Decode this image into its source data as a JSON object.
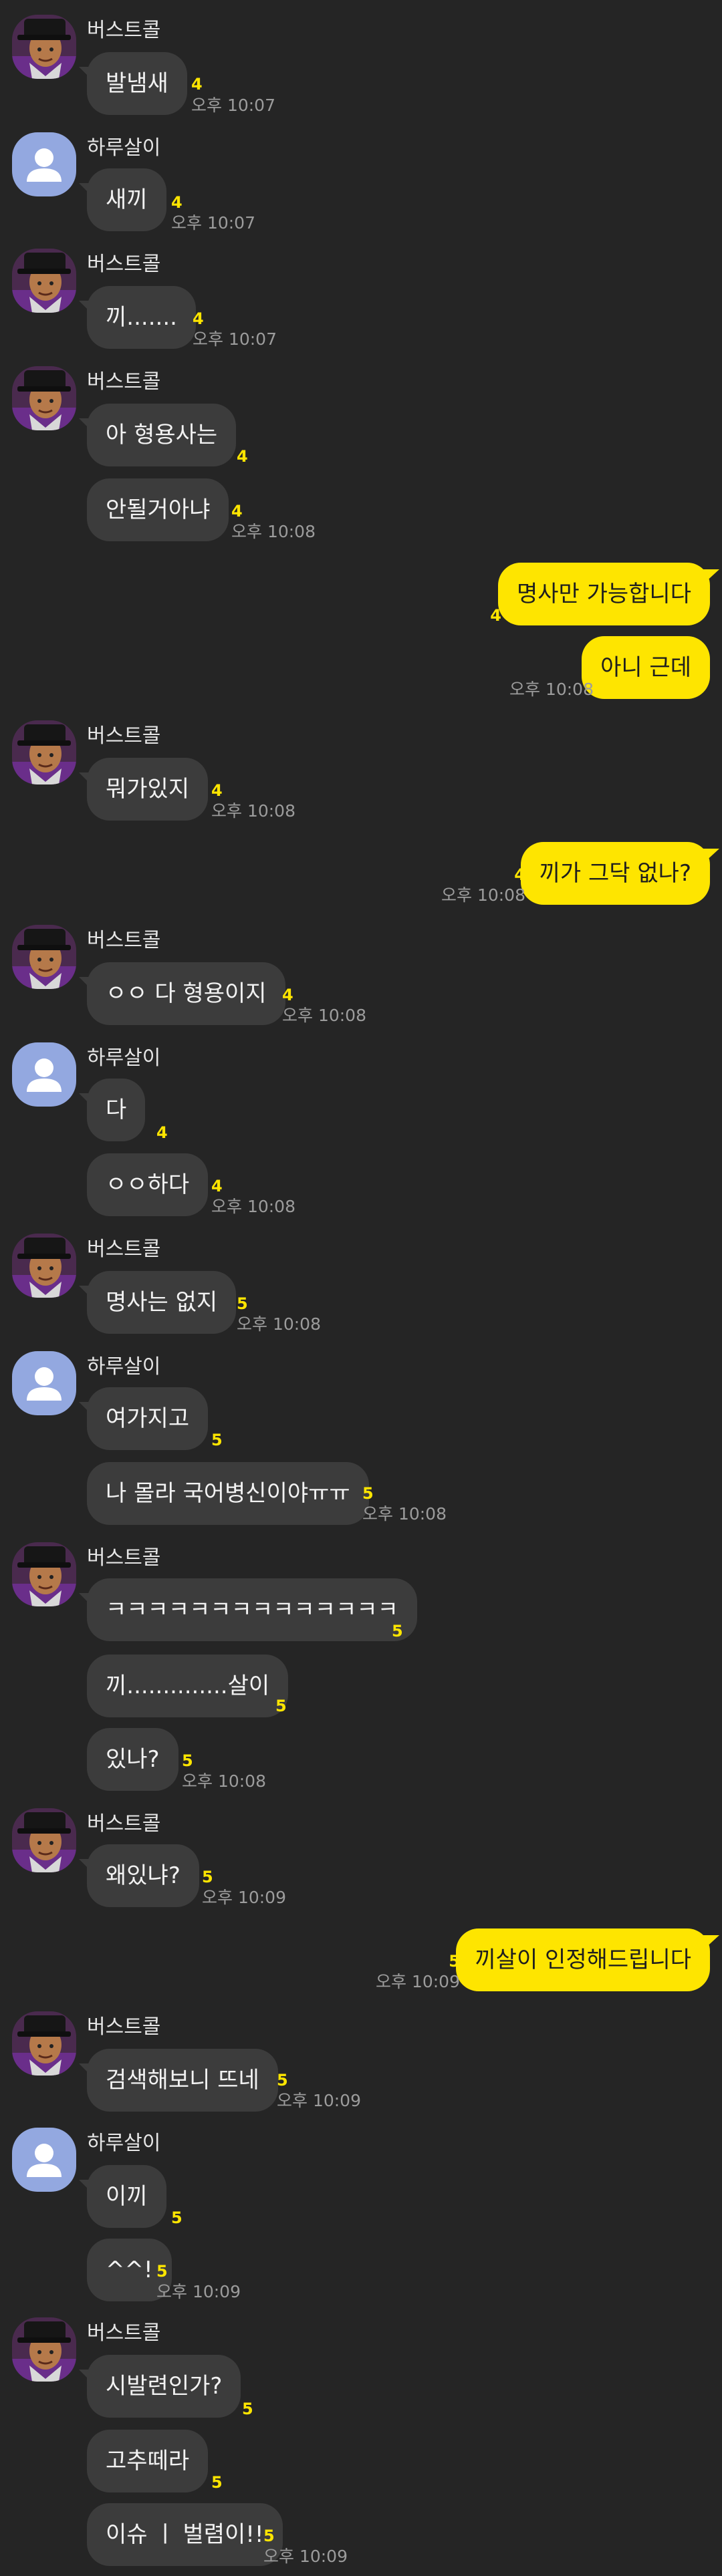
{
  "users": {
    "buster": "버스트콜",
    "harusari": "하루살이"
  },
  "messages": [
    {
      "id": 1,
      "text": "발냄새",
      "unread": "4",
      "time": "오후 10:07"
    },
    {
      "id": 2,
      "text": "새끼",
      "unread": "4",
      "time": "오후 10:07"
    },
    {
      "id": 3,
      "text": "끼.......",
      "unread": "4",
      "time": "오후 10:07"
    },
    {
      "id": 4,
      "text": "아 형용사는",
      "unread": "4",
      "time": ""
    },
    {
      "id": 5,
      "text": "안될거아냐",
      "unread": "4",
      "time": "오후 10:08"
    },
    {
      "id": 6,
      "text": "명사만 가능합니다",
      "unread": "4",
      "time": ""
    },
    {
      "id": 7,
      "text": "아니 근데",
      "unread": "4",
      "time": "오후 10:08"
    },
    {
      "id": 8,
      "text": "뭐가있지",
      "unread": "4",
      "time": "오후 10:08"
    },
    {
      "id": 9,
      "text": "끼가 그닥 없나?",
      "unread": "4",
      "time": "오후 10:08"
    },
    {
      "id": 10,
      "text": "ㅇㅇ 다 형용이지",
      "unread": "4",
      "time": "오후 10:08"
    },
    {
      "id": 11,
      "text": "다",
      "unread": "4",
      "time": ""
    },
    {
      "id": 12,
      "text": "ㅇㅇ하다",
      "unread": "4",
      "time": "오후 10:08"
    },
    {
      "id": 13,
      "text": "명사는 없지",
      "unread": "5",
      "time": "오후 10:08"
    },
    {
      "id": 14,
      "text": "여가지고",
      "unread": "5",
      "time": ""
    },
    {
      "id": 15,
      "text": "나 몰라 국어병신이야ㅠㅠ",
      "unread": "5",
      "time": "오후 10:08"
    },
    {
      "id": 16,
      "text": "ㅋㅋㅋㅋㅋㅋㅋㅋㅋㅋㅋㅋㅋㅋ",
      "unread": "5",
      "time": ""
    },
    {
      "id": 17,
      "text": "끼..............살이",
      "unread": "5",
      "time": ""
    },
    {
      "id": 18,
      "text": "있나?",
      "unread": "5",
      "time": "오후 10:08"
    },
    {
      "id": 19,
      "text": "왜있냐?",
      "unread": "5",
      "time": "오후 10:09"
    },
    {
      "id": 20,
      "text": "끼살이 인정해드립니다",
      "unread": "5",
      "time": "오후 10:09"
    },
    {
      "id": 21,
      "text": "검색해보니 뜨네",
      "unread": "5",
      "time": "오후 10:09"
    },
    {
      "id": 22,
      "text": "이끼",
      "unread": "5",
      "time": ""
    },
    {
      "id": 23,
      "text": "^^!",
      "unread": "5",
      "time": "오후 10:09"
    },
    {
      "id": 24,
      "text": "시발련인가?",
      "unread": "5",
      "time": ""
    },
    {
      "id": 25,
      "text": "고추떼라",
      "unread": "5",
      "time": ""
    },
    {
      "id": 26,
      "text": "이슈 ㅣ 벌렴이!!",
      "unread": "5",
      "time": "오후 10:09"
    }
  ]
}
